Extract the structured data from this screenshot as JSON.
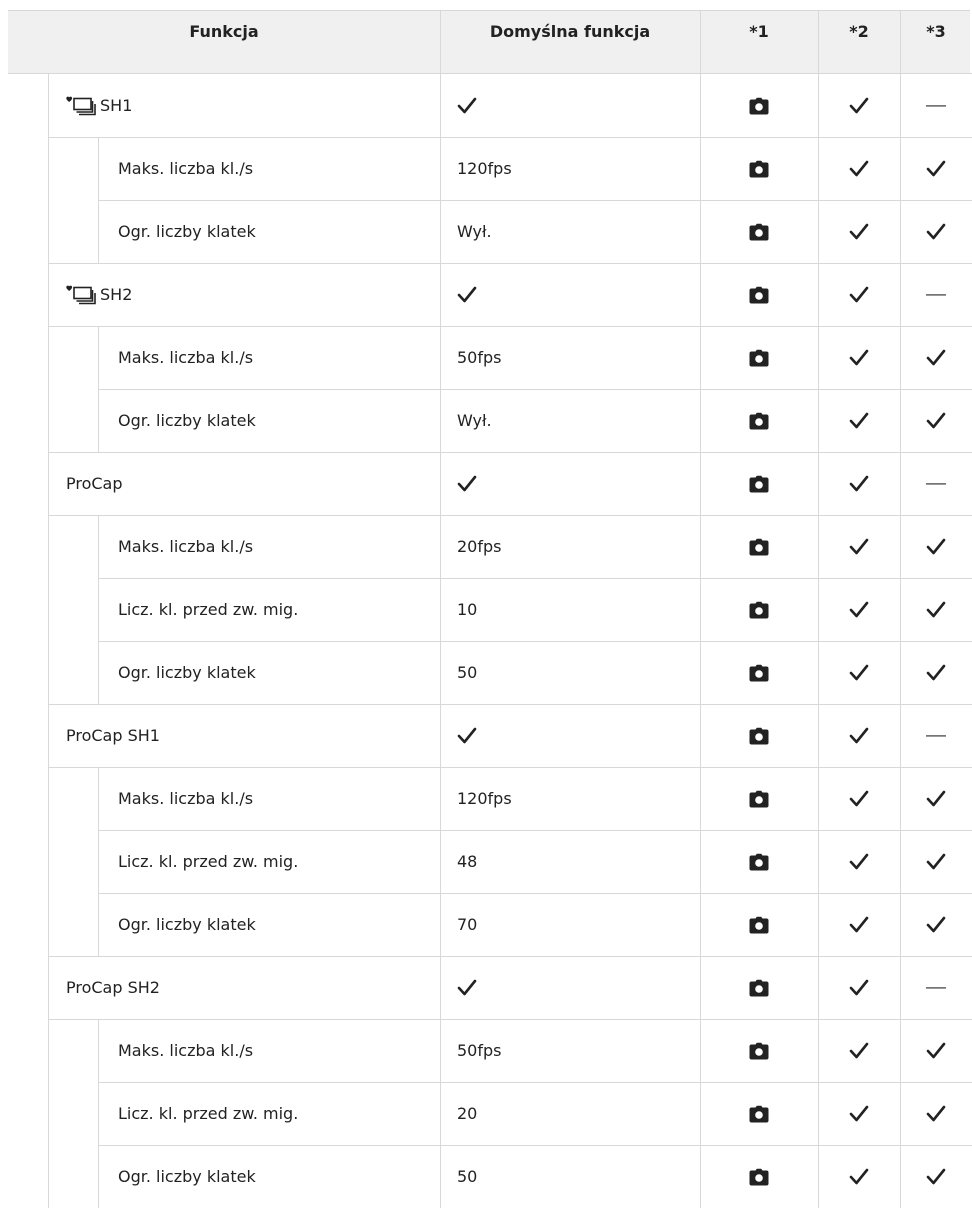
{
  "header": {
    "col_funkcja": "Funkcja",
    "col_default": "Domyślna funkcja",
    "col_1": "*1",
    "col_2": "*2",
    "col_3": "*3"
  },
  "rows": [
    {
      "level": 1,
      "icon": "heart-burst-icon",
      "label": "SH1",
      "default": "",
      "default_check": true,
      "c1": "camera-icon",
      "c2": "check",
      "c3": "dash"
    },
    {
      "level": 2,
      "label": "Maks. liczba kl./s",
      "default": "120fps",
      "default_check": false,
      "c1": "camera-icon",
      "c2": "check",
      "c3": "check"
    },
    {
      "level": 2,
      "label": "Ogr. liczby klatek",
      "default": "Wył.",
      "default_check": false,
      "c1": "camera-icon",
      "c2": "check",
      "c3": "check"
    },
    {
      "level": 1,
      "icon": "heart-burst-icon",
      "label": "SH2",
      "default": "",
      "default_check": true,
      "c1": "camera-icon",
      "c2": "check",
      "c3": "dash"
    },
    {
      "level": 2,
      "label": "Maks. liczba kl./s",
      "default": "50fps",
      "default_check": false,
      "c1": "camera-icon",
      "c2": "check",
      "c3": "check"
    },
    {
      "level": 2,
      "label": "Ogr. liczby klatek",
      "default": "Wył.",
      "default_check": false,
      "c1": "camera-icon",
      "c2": "check",
      "c3": "check"
    },
    {
      "level": 1,
      "label": "ProCap",
      "default": "",
      "default_check": true,
      "c1": "camera-icon",
      "c2": "check",
      "c3": "dash"
    },
    {
      "level": 2,
      "label": "Maks. liczba kl./s",
      "default": "20fps",
      "default_check": false,
      "c1": "camera-icon",
      "c2": "check",
      "c3": "check"
    },
    {
      "level": 2,
      "label": "Licz. kl. przed zw. mig.",
      "default": "10",
      "default_check": false,
      "c1": "camera-icon",
      "c2": "check",
      "c3": "check"
    },
    {
      "level": 2,
      "label": "Ogr. liczby klatek",
      "default": "50",
      "default_check": false,
      "c1": "camera-icon",
      "c2": "check",
      "c3": "check"
    },
    {
      "level": 1,
      "label": "ProCap SH1",
      "default": "",
      "default_check": true,
      "c1": "camera-icon",
      "c2": "check",
      "c3": "dash"
    },
    {
      "level": 2,
      "label": "Maks. liczba kl./s",
      "default": "120fps",
      "default_check": false,
      "c1": "camera-icon",
      "c2": "check",
      "c3": "check"
    },
    {
      "level": 2,
      "label": "Licz. kl. przed zw. mig.",
      "default": "48",
      "default_check": false,
      "c1": "camera-icon",
      "c2": "check",
      "c3": "check"
    },
    {
      "level": 2,
      "label": "Ogr. liczby klatek",
      "default": "70",
      "default_check": false,
      "c1": "camera-icon",
      "c2": "check",
      "c3": "check"
    },
    {
      "level": 1,
      "label": "ProCap SH2",
      "default": "",
      "default_check": true,
      "c1": "camera-icon",
      "c2": "check",
      "c3": "dash"
    },
    {
      "level": 2,
      "label": "Maks. liczba kl./s",
      "default": "50fps",
      "default_check": false,
      "c1": "camera-icon",
      "c2": "check",
      "c3": "check"
    },
    {
      "level": 2,
      "label": "Licz. kl. przed zw. mig.",
      "default": "20",
      "default_check": false,
      "c1": "camera-icon",
      "c2": "check",
      "c3": "check"
    },
    {
      "level": 2,
      "label": "Ogr. liczby klatek",
      "default": "50",
      "default_check": false,
      "c1": "camera-icon",
      "c2": "check",
      "c3": "check"
    }
  ],
  "colors": {
    "header_bg": "#f0f0f0",
    "grid": "#d8d8d8",
    "text": "#222222"
  }
}
